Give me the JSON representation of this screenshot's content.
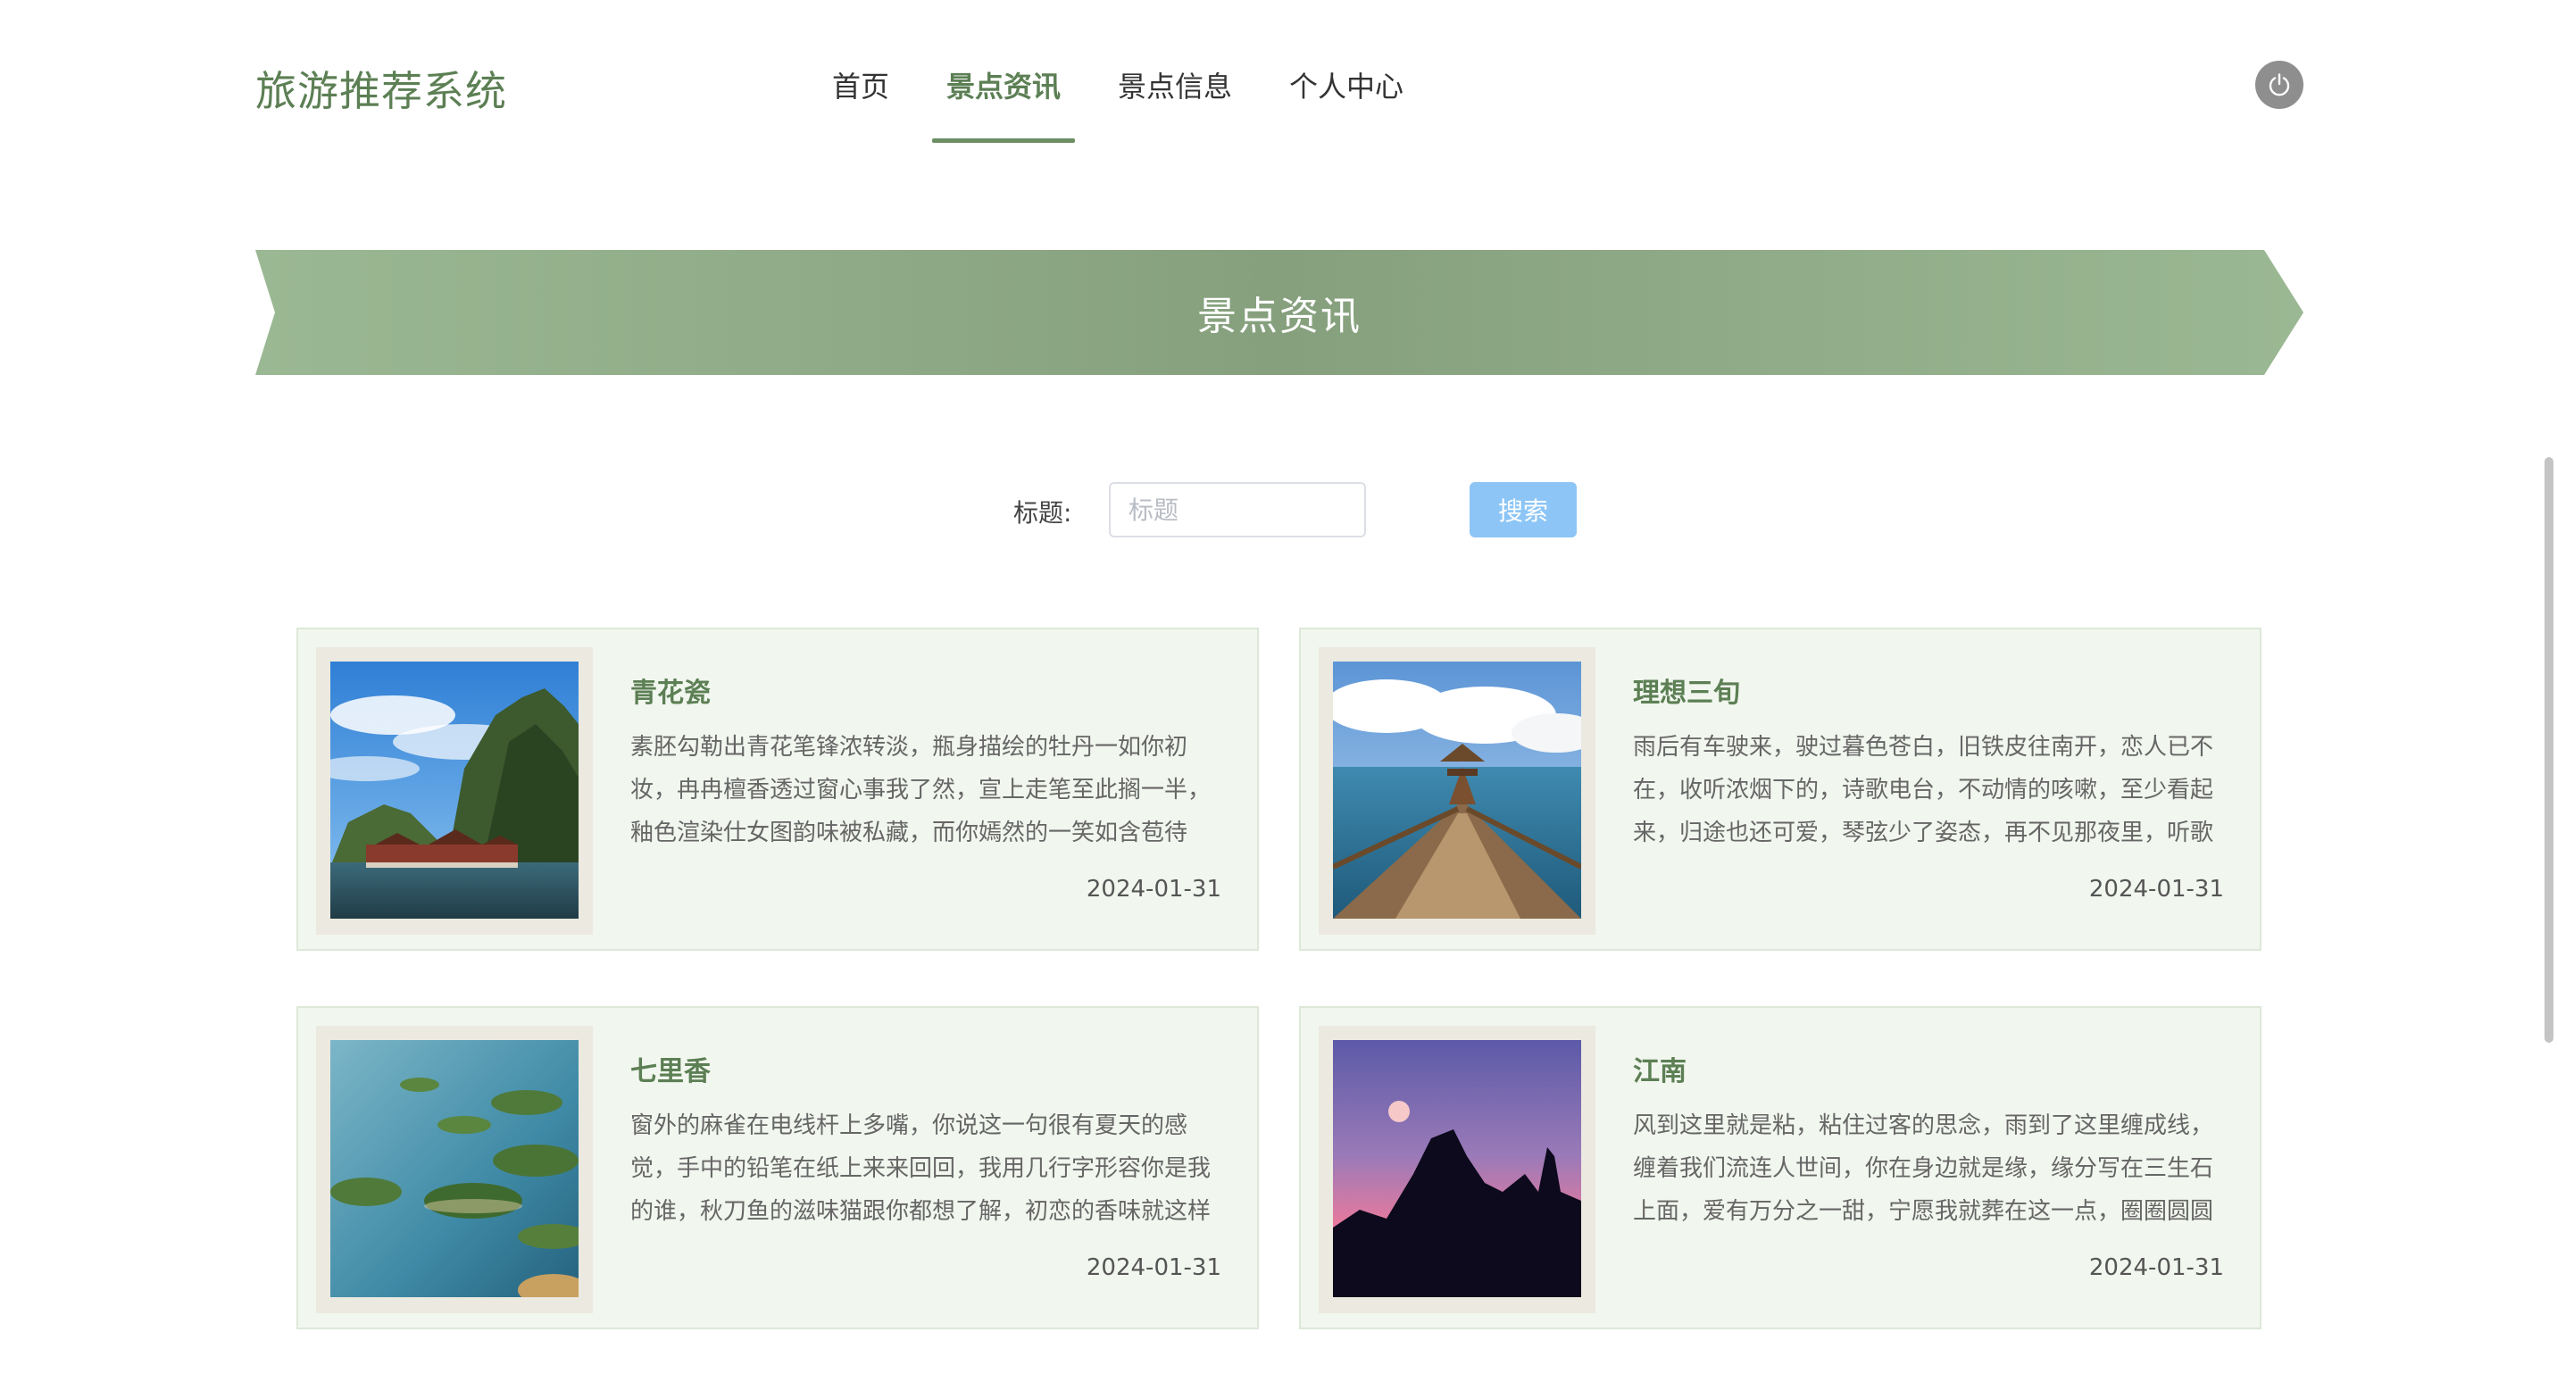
{
  "header": {
    "brand": "旅游推荐系统",
    "nav": [
      {
        "label": "首页",
        "active": false
      },
      {
        "label": "景点资讯",
        "active": true
      },
      {
        "label": "景点信息",
        "active": false
      },
      {
        "label": "个人中心",
        "active": false
      }
    ],
    "logout_icon": "power-icon"
  },
  "banner": {
    "title": "景点资讯"
  },
  "search": {
    "label": "标题:",
    "placeholder": "标题",
    "value": "",
    "button_label": "搜索"
  },
  "cards": [
    {
      "title": "青花瓷",
      "desc": "素胚勾勒出青花笔锋浓转淡，瓶身描绘的牡丹一如你初妆，冉冉檀香透过窗心事我了然，宣上走笔至此搁一半，釉色渲染仕女图韵味被私藏，而你嫣然的一笑如含苞待",
      "date": "2024-01-31",
      "image": "karst-lake-pavilion"
    },
    {
      "title": "理想三旬",
      "desc": "雨后有车驶来，驶过暮色苍白，旧铁皮往南开，恋人已不在，收听浓烟下的，诗歌电台，不动情的咳嗽，至少看起来，归途也还可爱，琴弦少了姿态，再不见那夜里，听歌",
      "date": "2024-01-31",
      "image": "seaside-pier"
    },
    {
      "title": "七里香",
      "desc": "窗外的麻雀在电线杆上多嘴，你说这一句很有夏天的感觉，手中的铅笔在纸上来来回回，我用几行字形容你是我的谁，秋刀鱼的滋味猫跟你都想了解，初恋的香味就这样",
      "date": "2024-01-31",
      "image": "island-lake"
    },
    {
      "title": "江南",
      "desc": "风到这里就是粘，粘住过客的思念，雨到了这里缠成线，缠着我们流连人世间，你在身边就是缘，缘分写在三生石上面，爱有万分之一甜，宁愿我就葬在这一点，圈圈圆圆",
      "date": "2024-01-31",
      "image": "mountain-sunset"
    }
  ],
  "colors": {
    "brand": "#5c7f54",
    "banner_dark": "#87a07e",
    "banner_light": "#9ab893",
    "card_bg": "#f1f6ee",
    "search_button": "#8cc5f6"
  }
}
